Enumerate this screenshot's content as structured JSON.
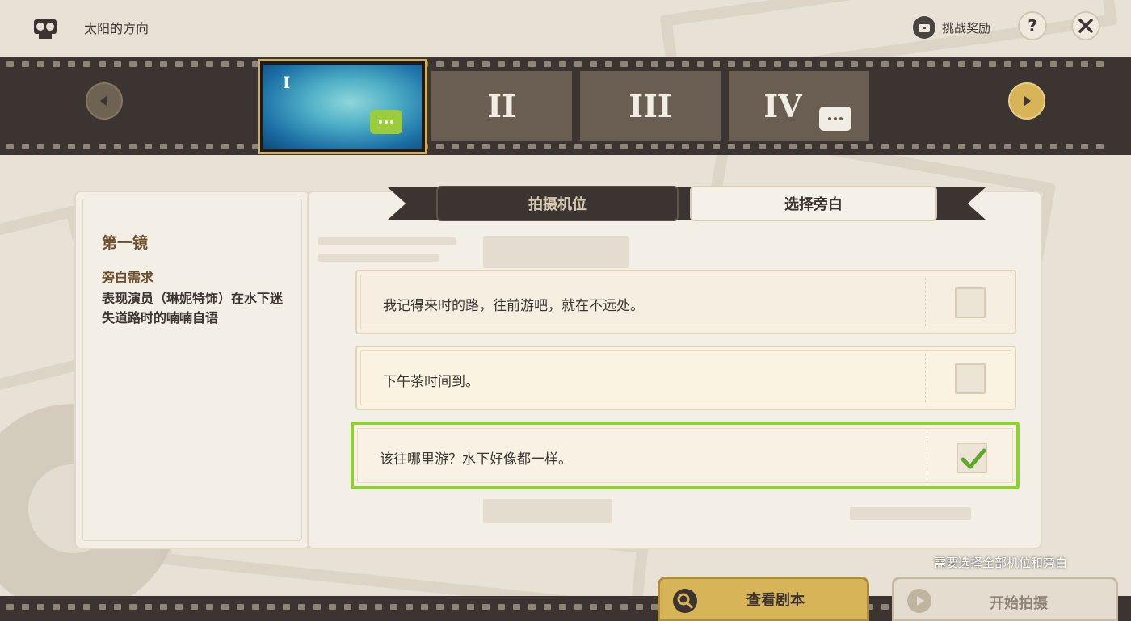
{
  "header": {
    "event_title": "太阳的方向",
    "rewards_label": "挑战奖励",
    "help_label": "?"
  },
  "filmstrip": {
    "frames": [
      {
        "label": "I",
        "selected": true,
        "has_narration": true
      },
      {
        "label": "II",
        "selected": false,
        "has_narration": false
      },
      {
        "label": "III",
        "selected": false,
        "has_narration": false
      },
      {
        "label": "IV",
        "selected": false,
        "has_narration": true
      }
    ]
  },
  "shot": {
    "title": "第一镜",
    "requirement_label": "旁白需求",
    "requirement_text": "表现演员（琳妮特饰）在水下迷失道路时的喃喃自语"
  },
  "tabs": [
    {
      "label": "拍摄机位",
      "active": false
    },
    {
      "label": "选择旁白",
      "active": true
    }
  ],
  "options": [
    {
      "text": "我记得来时的路，往前游吧，就在不远处。",
      "checked": false
    },
    {
      "text": "下午茶时间到。",
      "checked": false
    },
    {
      "text": "该往哪里游？水下好像都一样。",
      "checked": true
    }
  ],
  "footer": {
    "hint": "需要选择全部机位和旁白",
    "view_script_label": "查看剧本",
    "start_label": "开始拍摄"
  },
  "colors": {
    "accent_gold": "#d7b458",
    "selected_green": "#8ed132",
    "film_dark": "#3b3430"
  }
}
